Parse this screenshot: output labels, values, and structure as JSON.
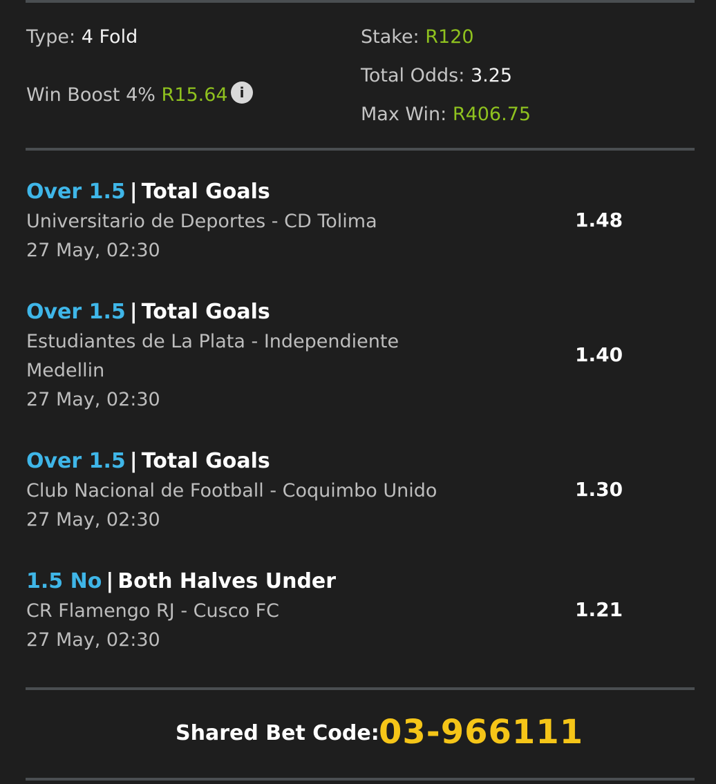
{
  "summary": {
    "type_label": "Type:",
    "type_value": "4 Fold",
    "boost_label": "Win Boost 4%",
    "boost_value": "R15.64",
    "stake_label": "Stake:",
    "stake_value": "R120",
    "odds_label": "Total Odds:",
    "odds_value": "3.25",
    "maxwin_label": "Max Win:",
    "maxwin_value": "R406.75"
  },
  "colors": {
    "background": "#1e1e1e",
    "pick_blue": "#3fb6e8",
    "money_green": "#8fc21f",
    "code_yellow": "#f5c518"
  },
  "icons": {
    "info": "info-icon"
  },
  "selections": [
    {
      "pick": "Over 1.5",
      "separator": "|",
      "market": "Total Goals",
      "match": "Universitario de Deportes - CD Tolima",
      "time": "27 May, 02:30",
      "odds": "1.48"
    },
    {
      "pick": "Over 1.5",
      "separator": "|",
      "market": "Total Goals",
      "match": "Estudiantes de La Plata - Independiente Medellin",
      "time": "27 May, 02:30",
      "odds": "1.40"
    },
    {
      "pick": "Over 1.5",
      "separator": "|",
      "market": "Total Goals",
      "match": "Club Nacional de Football - Coquimbo Unido",
      "time": "27 May, 02:30",
      "odds": "1.30"
    },
    {
      "pick": "1.5 No",
      "separator": "|",
      "market": "Both Halves Under",
      "match": "CR Flamengo RJ - Cusco FC",
      "time": "27 May, 02:30",
      "odds": "1.21"
    }
  ],
  "share": {
    "label": "Shared Bet Code:",
    "code": "03-966111"
  }
}
